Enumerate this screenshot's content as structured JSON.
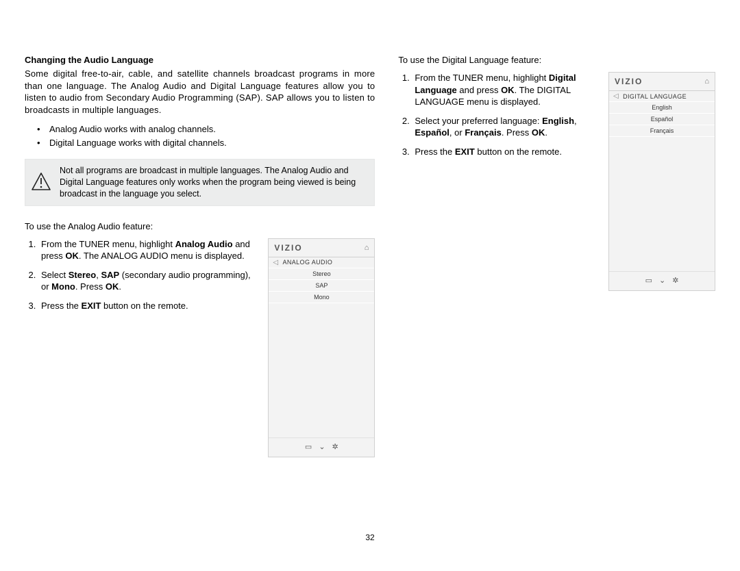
{
  "section_title": "Changing the Audio Language",
  "intro": "Some digital free-to-air, cable, and satellite channels broadcast programs in more than one language. The Analog Audio and Digital Language features allow you to listen to audio from Secondary Audio Programming (SAP). SAP allows you to listen to broadcasts in multiple languages.",
  "bullets": [
    "Analog Audio works with analog channels.",
    "Digital Language works with digital channels."
  ],
  "warning": "Not all programs are broadcast in multiple languages. The Analog Audio and Digital Language features only works when the program being viewed is being broadcast in the language you select.",
  "analog": {
    "lead": "To use the Analog Audio feature:",
    "steps": {
      "s1_a": "From the TUNER menu, highlight ",
      "s1_b": "Analog Audio",
      "s1_c": " and press ",
      "s1_d": "OK",
      "s1_e": ". The ANALOG AUDIO menu is displayed.",
      "s2_a": "Select ",
      "s2_b": "Stereo",
      "s2_c": ", ",
      "s2_d": "SAP",
      "s2_e": " (secondary audio programming), or ",
      "s2_f": "Mono",
      "s2_g": ". Press ",
      "s2_h": "OK",
      "s2_i": ".",
      "s3_a": "Press the ",
      "s3_b": "EXIT",
      "s3_c": " button on the remote."
    },
    "panel": {
      "logo": "VIZIO",
      "title": "ANALOG AUDIO",
      "items": [
        "Stereo",
        "SAP",
        "Mono"
      ]
    }
  },
  "digital": {
    "lead": "To use the Digital Language feature:",
    "steps": {
      "s1_a": "From the TUNER menu, highlight ",
      "s1_b": "Digital Language",
      "s1_c": " and press ",
      "s1_d": "OK",
      "s1_e": ". The DIGITAL LANGUAGE menu is displayed.",
      "s2_a": "Select your preferred language: ",
      "s2_b": "English",
      "s2_c": ", ",
      "s2_d": "Español",
      "s2_e": ", or ",
      "s2_f": "Français",
      "s2_g": ". Press ",
      "s2_h": "OK",
      "s2_i": ".",
      "s3_a": "Press the ",
      "s3_b": "EXIT",
      "s3_c": " button on the remote."
    },
    "panel": {
      "logo": "VIZIO",
      "title": "DIGITAL LANGUAGE",
      "items": [
        "English",
        "Español",
        "Français"
      ]
    }
  },
  "page_number": "32"
}
